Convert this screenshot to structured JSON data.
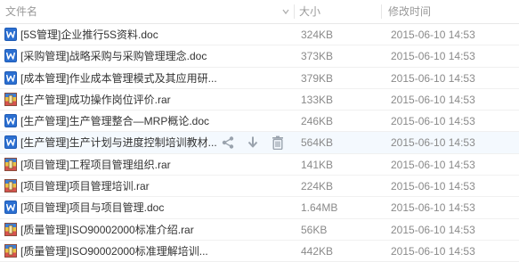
{
  "header": {
    "name_label": "文件名",
    "size_label": "大小",
    "time_label": "修改时间"
  },
  "colors": {
    "doc_icon": "#2b6fd1",
    "rar_icon": "#d9534f",
    "action_icon": "#9aa3ad",
    "hover_row": "#f4f9fe"
  },
  "files": [
    {
      "name": "[5S管理]企业推行5S资料.doc",
      "size": "324KB",
      "time": "2015-06-10 14:53",
      "icon": "word-doc-icon"
    },
    {
      "name": "[采购管理]战略采购与采购管理理念.doc",
      "size": "373KB",
      "time": "2015-06-10 14:53",
      "icon": "word-doc-icon"
    },
    {
      "name": "[成本管理]作业成本管理模式及其应用研...",
      "size": "379KB",
      "time": "2015-06-10 14:53",
      "icon": "word-doc-icon"
    },
    {
      "name": "[生产管理]成功操作岗位评价.rar",
      "size": "133KB",
      "time": "2015-06-10 14:53",
      "icon": "rar-archive-icon"
    },
    {
      "name": "[生产管理]生产管理整合—MRP概论.doc",
      "size": "246KB",
      "time": "2015-06-10 14:53",
      "icon": "word-doc-icon"
    },
    {
      "name": "[生产管理]生产计划与进度控制培训教材...",
      "size": "564KB",
      "time": "2015-06-10 14:53",
      "icon": "word-doc-icon",
      "hover": true
    },
    {
      "name": "[项目管理]工程项目管理组织.rar",
      "size": "141KB",
      "time": "2015-06-10 14:53",
      "icon": "rar-archive-icon"
    },
    {
      "name": "[项目管理]项目管理培训.rar",
      "size": "224KB",
      "time": "2015-06-10 14:53",
      "icon": "rar-archive-icon"
    },
    {
      "name": "[项目管理]项目与项目管理.doc",
      "size": "1.64MB",
      "time": "2015-06-10 14:53",
      "icon": "word-doc-icon"
    },
    {
      "name": "[质量管理]ISO90002000标准介绍.rar",
      "size": "56KB",
      "time": "2015-06-10 14:53",
      "icon": "rar-archive-icon"
    },
    {
      "name": "[质量管理]ISO90002000标准理解培训...",
      "size": "442KB",
      "time": "2015-06-10 14:53",
      "icon": "rar-archive-icon"
    }
  ],
  "row_actions": [
    {
      "icon": "share-icon"
    },
    {
      "icon": "download-icon"
    },
    {
      "icon": "delete-icon"
    }
  ]
}
